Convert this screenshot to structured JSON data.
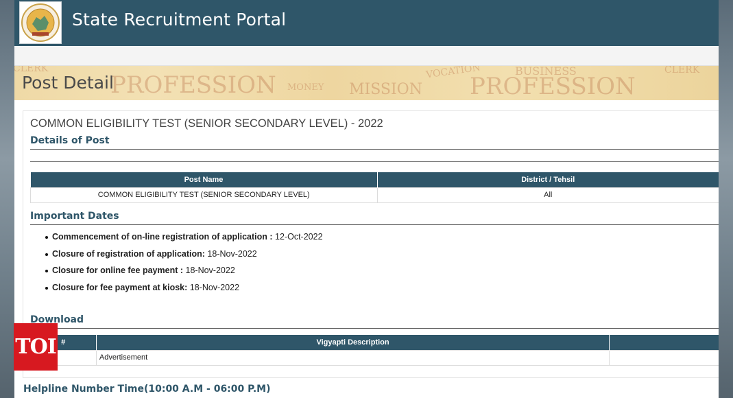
{
  "header": {
    "portal_title": "State Recruitment Portal",
    "logo_icon": "state-emblem-icon"
  },
  "banner": {
    "heading": "Post Detail",
    "watermarks": [
      "CLERK",
      "PROFESSION",
      "MONEY",
      "MISSION",
      "VOCATION",
      "BUSINESS",
      "CLERK",
      "PROFESSION"
    ]
  },
  "post": {
    "title": "COMMON ELIGIBILITY TEST (SENIOR SECONDARY LEVEL) - 2022"
  },
  "details": {
    "heading": "Details of Post",
    "columns": [
      "Post Name",
      "District / Tehsil"
    ],
    "rows": [
      [
        "COMMON ELIGIBILITY TEST (SENIOR SECONDARY LEVEL)",
        "All"
      ]
    ]
  },
  "important_dates": {
    "heading": "Important Dates",
    "items": [
      {
        "label": "Commencement of on-line registration of application :",
        "value": "12-Oct-2022"
      },
      {
        "label": "Closure of registration of application:",
        "value": "18-Nov-2022"
      },
      {
        "label": "Closure for online fee payment :",
        "value": "18-Nov-2022"
      },
      {
        "label": "Closure for fee payment at kiosk:",
        "value": "18-Nov-2022"
      }
    ]
  },
  "download": {
    "heading": "Download",
    "columns": [
      "#",
      "Vigyapti Description",
      ""
    ],
    "rows": [
      [
        "",
        "Advertisement",
        ""
      ]
    ]
  },
  "helpline": {
    "text": "Helpline Number Time(10:00 A.M - 06:00 P.M)"
  },
  "overlay": {
    "badge": "TOI"
  },
  "colors": {
    "primary": "#2f5669",
    "badge": "#d71920"
  }
}
